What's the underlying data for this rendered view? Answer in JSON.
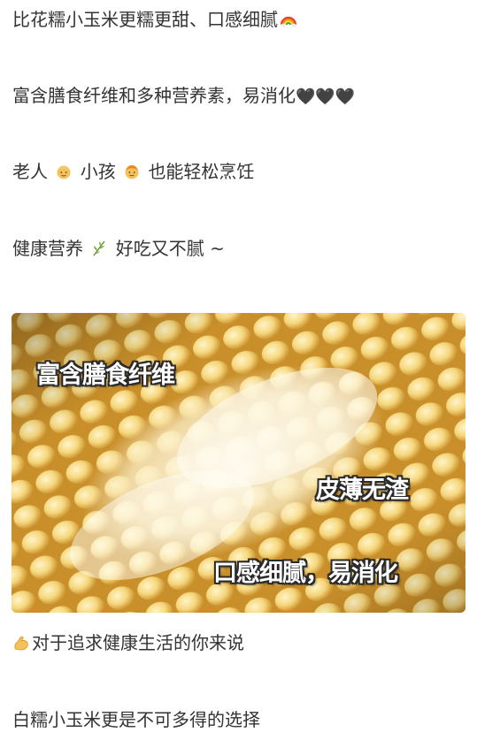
{
  "post": {
    "line1": {
      "text": "比花糯小玉米更糯更甜、口感细腻",
      "emoji": "rainbow-icon"
    },
    "line2": {
      "text": "富含膳食纤维和多种营养素，易消化",
      "hearts": "🖤🖤🖤"
    },
    "line3": {
      "part1": "老人",
      "part2": "小孩",
      "part3": "也能轻松烹饪"
    },
    "line4": {
      "part1": "健康营养",
      "part2": "好吃又不腻 ~"
    },
    "line5": {
      "text": "对于追求健康生活的你来说"
    },
    "line6": {
      "text": "白糯小玉米更是不可多得的选择"
    }
  },
  "image": {
    "overlay_1": "富含膳食纤维",
    "overlay_2": "皮薄无渣",
    "overlay_3": "口感细腻，易消化"
  },
  "icons": {
    "rainbow": "rainbow-icon",
    "hearts": "black-heart-icon",
    "old_person": "older-person-icon",
    "child": "child-icon",
    "herb": "herb-icon",
    "muscle": "flexed-biceps-icon"
  },
  "colors": {
    "text": "#333333",
    "corn": "#f3d27a",
    "corn_shadow": "#c8922c"
  }
}
